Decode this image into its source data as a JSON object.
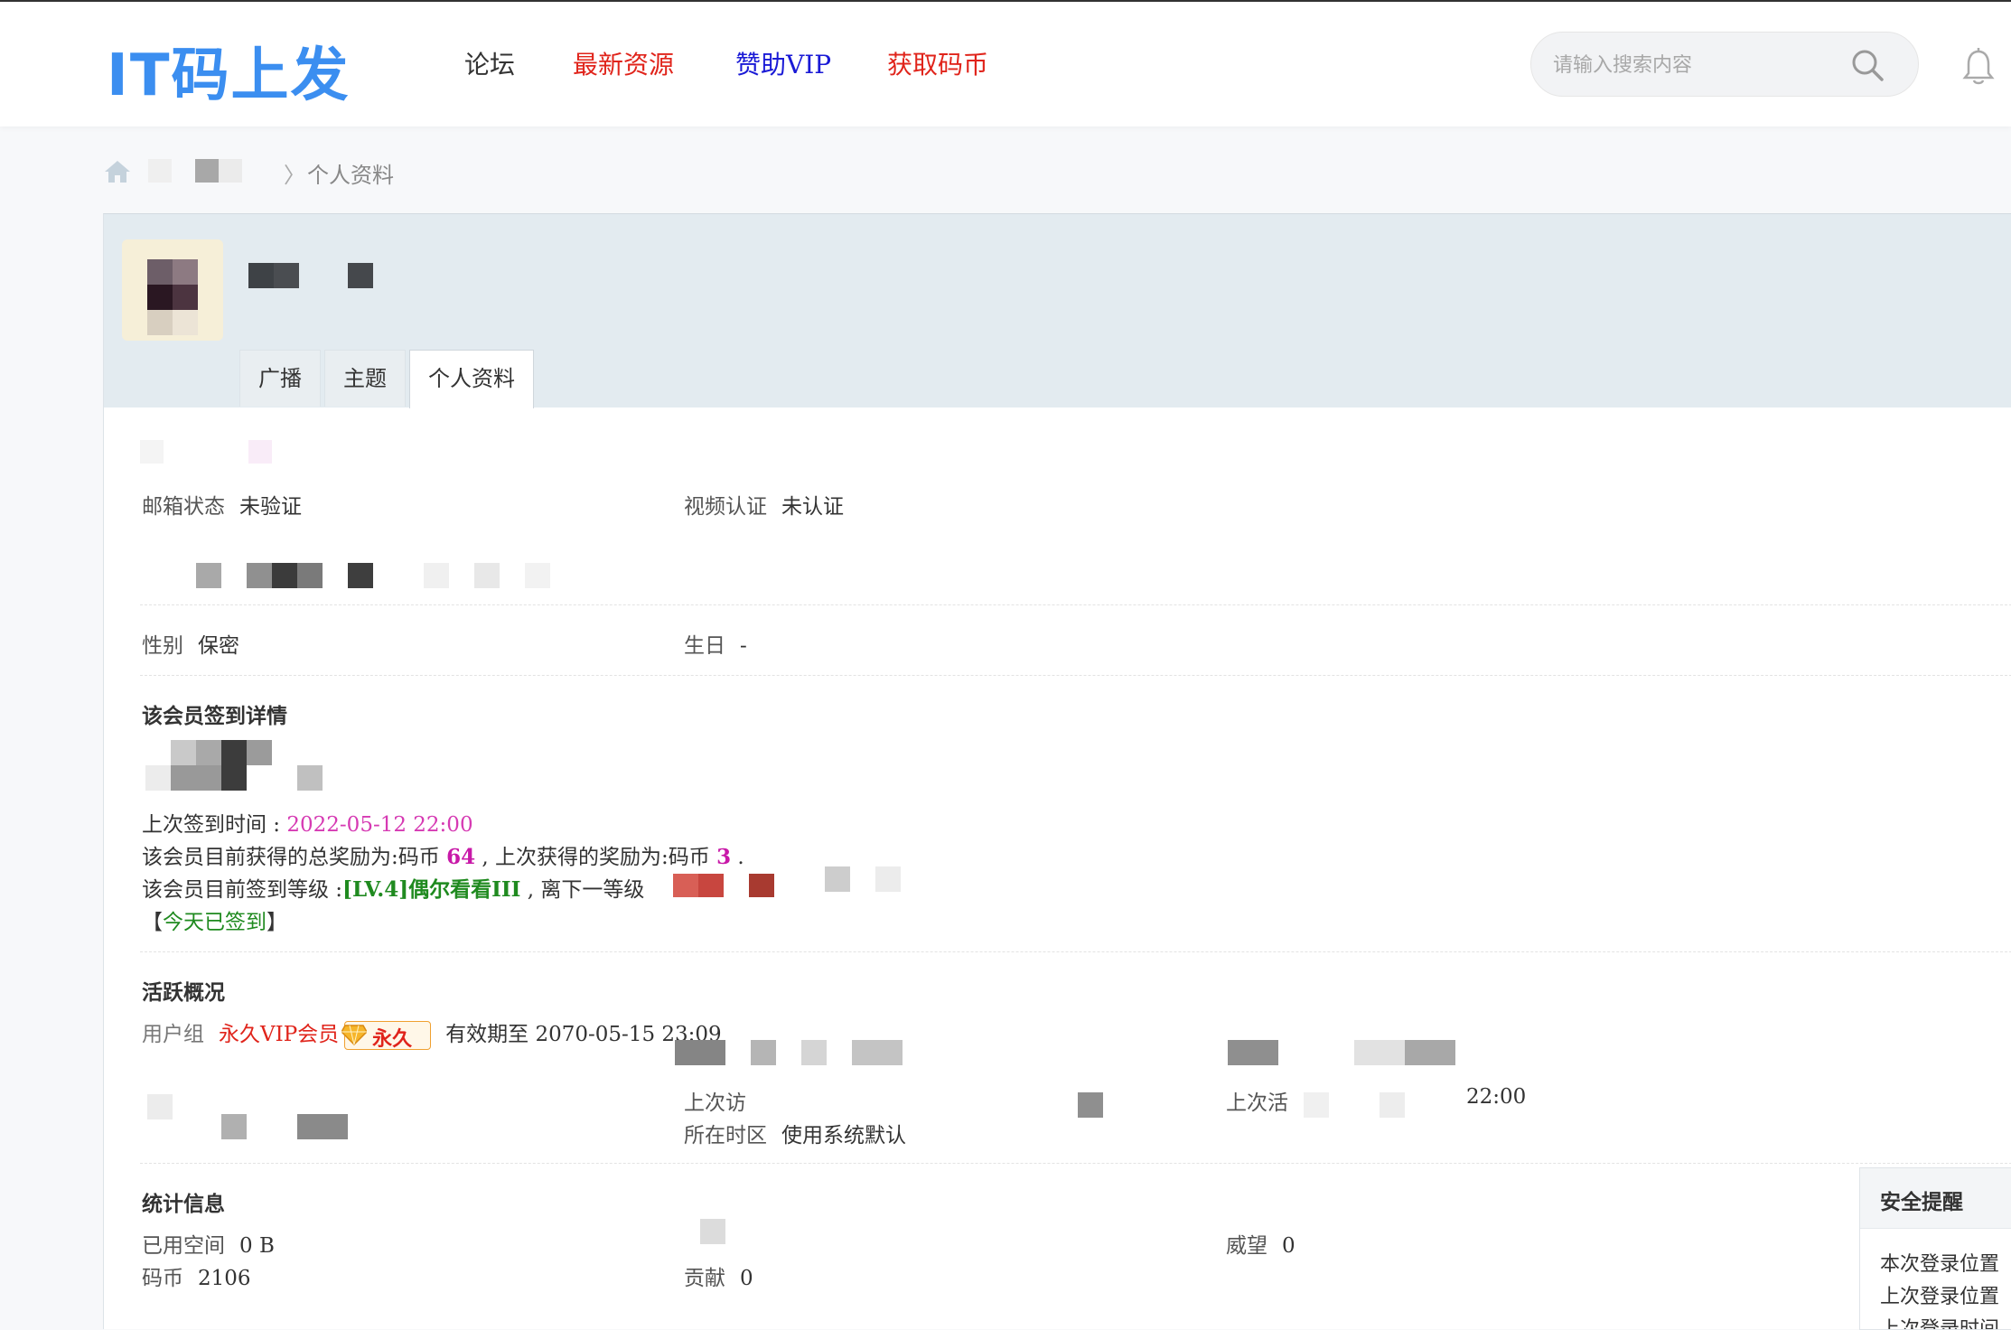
{
  "header": {
    "logo": "IT码上发",
    "nav": [
      {
        "label": "论坛",
        "color": "#333333"
      },
      {
        "label": "最新资源",
        "color": "#e0241b"
      },
      {
        "label": "赞助VIP",
        "color": "#1a1ad6"
      },
      {
        "label": "获取码币",
        "color": "#e0241b"
      }
    ],
    "search_placeholder": "请输入搜索内容"
  },
  "breadcrumb": {
    "separator": "〉",
    "current": "个人资料"
  },
  "tabs": [
    "广播",
    "主题",
    "个人资料"
  ],
  "active_tab": "个人资料",
  "status": {
    "email_label": "邮箱状态",
    "email_value": "未验证",
    "video_label": "视频认证",
    "video_value": "未认证"
  },
  "basic": {
    "gender_label": "性别",
    "gender_value": "保密",
    "birthday_label": "生日",
    "birthday_value": "-"
  },
  "checkin": {
    "title": "该会员签到详情",
    "last_time_label": "上次签到时间 : ",
    "last_time_value": "2022-05-12 22:00",
    "reward_prefix": "该会员目前获得的总奖励为:码币 ",
    "reward_total": "64",
    "reward_mid": " , 上次获得的奖励为:码币 ",
    "reward_last": "3",
    "reward_suffix": " .",
    "level_prefix": "该会员目前签到等级 :",
    "level_value": "[LV.4]偶尔看看III",
    "level_suffix": " , 离下一等级",
    "today_open": "【",
    "today_text": "今天已签到",
    "today_close": "】"
  },
  "activity": {
    "title": "活跃概况",
    "group_label": "用户组",
    "group_value": "永久VIP会员",
    "badge_text": "永久",
    "expire_text": "有效期至 2070-05-15 23:09",
    "last_visit_label": "上次访",
    "last_post_label": "上次活",
    "last_post_value": "22:00",
    "timezone_label": "所在时区",
    "timezone_value": "使用系统默认"
  },
  "stats": {
    "title": "统计信息",
    "space_label": "已用空间",
    "space_value": "0 B",
    "coin_label": "码币",
    "coin_value": "2106",
    "contrib_label": "贡献",
    "contrib_value": "0",
    "prestige_label": "威望",
    "prestige_value": "0"
  },
  "security": {
    "title": "安全提醒",
    "line1": "本次登录位置",
    "line2": "上次登录位置",
    "line3": "上次登录时间"
  }
}
